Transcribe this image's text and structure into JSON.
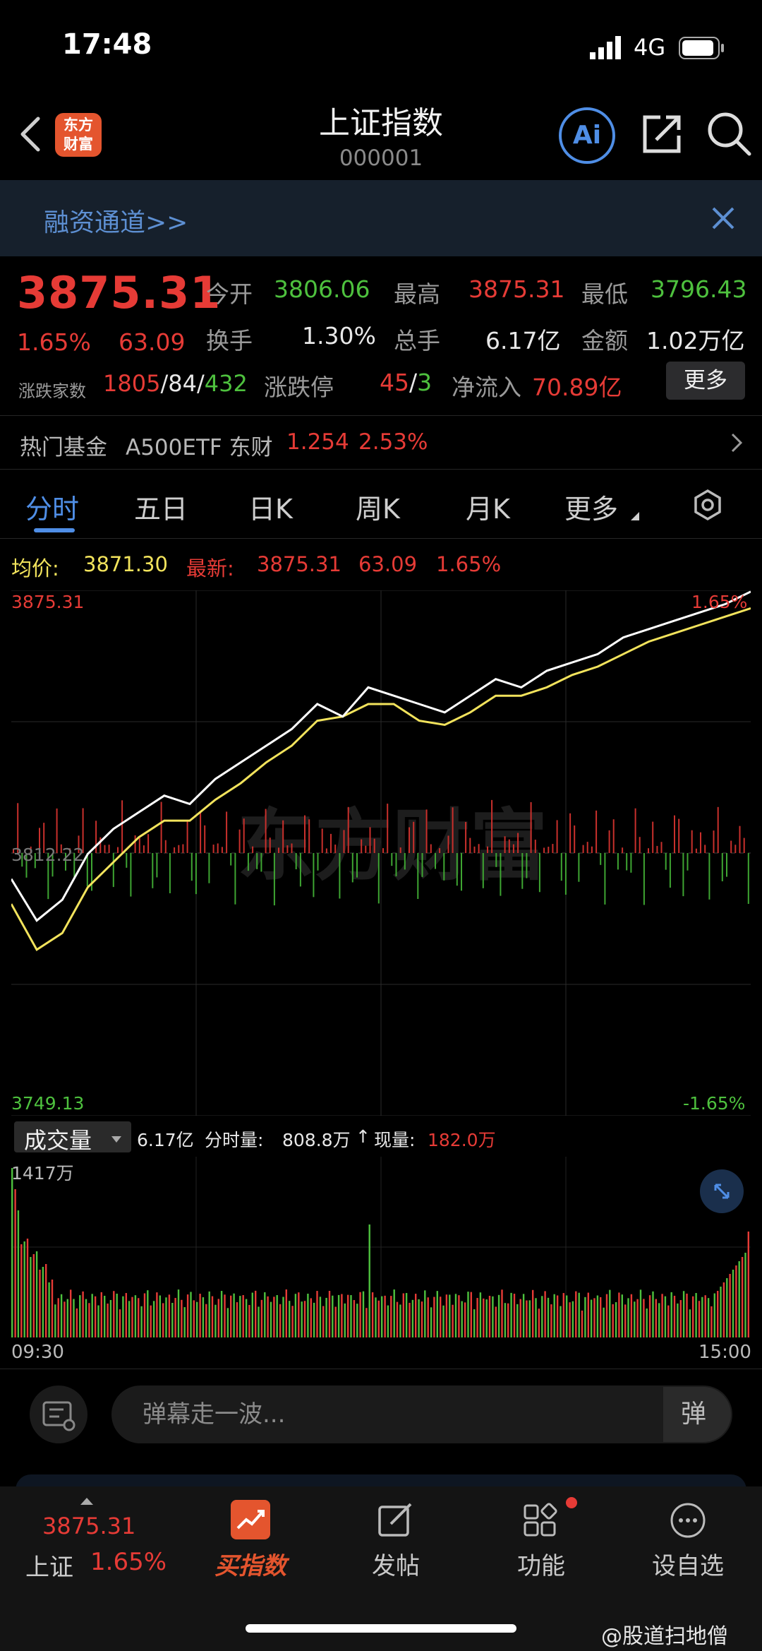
{
  "status_bar": {
    "time": "17:48",
    "network": "4G"
  },
  "header": {
    "logo_text_line1": "东方",
    "logo_text_line2": "财富",
    "title": "上证指数",
    "code": "000001",
    "ai_label": "Ai"
  },
  "banner": {
    "text": "融资通道>>"
  },
  "quote": {
    "price": "3875.31",
    "change_pct": "1.65%",
    "change": "63.09",
    "open_label": "今开",
    "open": "3806.06",
    "high_label": "最高",
    "high": "3875.31",
    "low_label": "最低",
    "low": "3796.43",
    "turnover_label": "换手",
    "turnover": "1.30%",
    "volume_label": "总手",
    "volume": "6.17亿",
    "amount_label": "金额",
    "amount": "1.02万亿",
    "breadth_label": "涨跌家数",
    "breadth_up": "1805",
    "breadth_sep1": "/",
    "breadth_flat": "84",
    "breadth_sep2": "/",
    "breadth_down": "432",
    "limit_label": "涨跌停",
    "limit_up": "45",
    "limit_sep": "/",
    "limit_down": "3",
    "inflow_label": "净流入",
    "inflow": "70.89亿",
    "more_label": "更多"
  },
  "hot_fund": {
    "label": "热门基金",
    "name": "A500ETF 东财",
    "price": "1.254",
    "pct": "2.53%"
  },
  "tabs": [
    "分时",
    "五日",
    "日K",
    "周K",
    "月K",
    "更多"
  ],
  "chart_info": {
    "avg_label": "均价:",
    "avg": "3871.30",
    "latest_label": "最新:",
    "latest": "3875.31",
    "latest_change": "63.09",
    "latest_pct": "1.65%"
  },
  "chart_data": {
    "type": "line",
    "y_top": "3875.31",
    "y_mid": "3812.22",
    "y_bottom": "3749.13",
    "pct_top": "1.65%",
    "pct_bottom": "-1.65%",
    "ylim": [
      3749.13,
      3875.31
    ],
    "x_start": "09:30",
    "x_end": "15:00",
    "watermark": "东方财富",
    "series": [
      {
        "values": [
          3806,
          3796,
          3801,
          3812,
          3818,
          3822,
          3826,
          3824,
          3830,
          3834,
          3838,
          3842,
          3848,
          3845,
          3852,
          3850,
          3848,
          3846,
          3850,
          3854,
          3852,
          3856,
          3858,
          3860,
          3864,
          3866,
          3868,
          3870,
          3872,
          3875
        ]
      },
      {
        "values": [
          3800,
          3789,
          3793,
          3804,
          3810,
          3816,
          3820,
          3820,
          3825,
          3829,
          3834,
          3838,
          3844,
          3845,
          3848,
          3848,
          3844,
          3843,
          3846,
          3850,
          3850,
          3852,
          3855,
          3857,
          3860,
          3863,
          3865,
          3867,
          3869,
          3871
        ]
      }
    ]
  },
  "volume": {
    "selector": "成交量",
    "total": "6.17亿",
    "period_label": "分时量:",
    "period": "808.8万",
    "now_label": "现量:",
    "now": "182.0万",
    "axis_max": "1417万",
    "ylim": [
      0,
      1417
    ]
  },
  "danmaku": {
    "placeholder": "弹幕走一波...",
    "toggle": "弹"
  },
  "bottom_nav": {
    "index_price": "3875.31",
    "index_name": "上证",
    "index_pct": "1.65%",
    "buy_label": "买指数",
    "post_label": "发帖",
    "func_label": "功能",
    "watch_label": "设自选"
  },
  "watermark": "@股道扫地僧",
  "colors": {
    "up": "#e63b36",
    "down": "#4ec13e",
    "accent": "#4f8ee6",
    "avg_line": "#f2e35c",
    "price_line": "#ffffff"
  }
}
